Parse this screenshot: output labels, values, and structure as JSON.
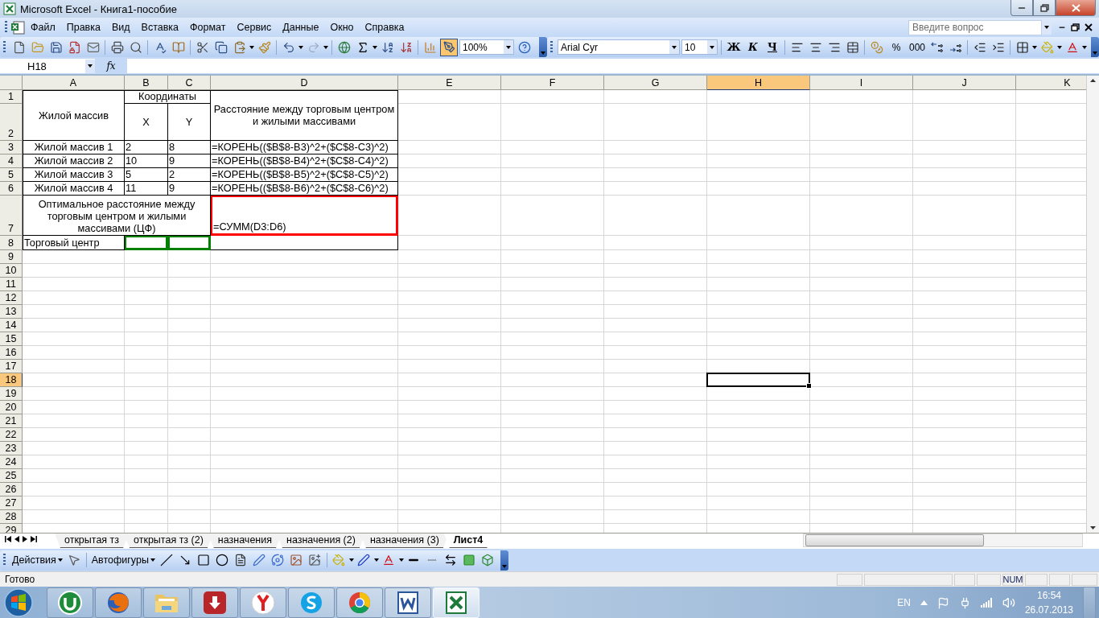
{
  "window": {
    "title": "Microsoft Excel - Книга1-пособие"
  },
  "menu": [
    "Файл",
    "Правка",
    "Вид",
    "Вставка",
    "Формат",
    "Сервис",
    "Данные",
    "Окно",
    "Справка"
  ],
  "help_search": {
    "placeholder": "Введите вопрос"
  },
  "standard_toolbar": {
    "zoom": "100%",
    "drawing_on": true
  },
  "formatting_toolbar": {
    "font": "Arial Cyr",
    "size": "10",
    "bold": "Ж",
    "italic": "К",
    "underline": "Ч",
    "percent": "%",
    "thousands": "000"
  },
  "formula_bar": {
    "name_box": "H18",
    "fx": "fx"
  },
  "columns": [
    {
      "label": "A",
      "selected": false
    },
    {
      "label": "B",
      "selected": false
    },
    {
      "label": "C",
      "selected": false
    },
    {
      "label": "D",
      "selected": false
    },
    {
      "label": "E",
      "selected": false
    },
    {
      "label": "F",
      "selected": false
    },
    {
      "label": "G",
      "selected": false
    },
    {
      "label": "H",
      "selected": true
    },
    {
      "label": "I",
      "selected": false
    },
    {
      "label": "J",
      "selected": false
    },
    {
      "label": "K",
      "selected": false
    }
  ],
  "rows": [
    {
      "label": "1",
      "selected": false
    },
    {
      "label": "2",
      "selected": false
    },
    {
      "label": "3",
      "selected": false
    },
    {
      "label": "4",
      "selected": false
    },
    {
      "label": "5",
      "selected": false
    },
    {
      "label": "6",
      "selected": false
    },
    {
      "label": "7",
      "selected": false
    },
    {
      "label": "8",
      "selected": false
    },
    {
      "label": "9",
      "selected": false
    },
    {
      "label": "10",
      "selected": false
    },
    {
      "label": "11",
      "selected": false
    },
    {
      "label": "12",
      "selected": false
    },
    {
      "label": "13",
      "selected": false
    },
    {
      "label": "14",
      "selected": false
    },
    {
      "label": "15",
      "selected": false
    },
    {
      "label": "16",
      "selected": false
    },
    {
      "label": "17",
      "selected": false
    },
    {
      "label": "18",
      "selected": true
    },
    {
      "label": "19",
      "selected": false
    },
    {
      "label": "20",
      "selected": false
    },
    {
      "label": "21",
      "selected": false
    },
    {
      "label": "22",
      "selected": false
    },
    {
      "label": "23",
      "selected": false
    },
    {
      "label": "24",
      "selected": false
    },
    {
      "label": "25",
      "selected": false
    },
    {
      "label": "26",
      "selected": false
    },
    {
      "label": "27",
      "selected": false
    },
    {
      "label": "28",
      "selected": false
    },
    {
      "label": "29",
      "selected": false
    }
  ],
  "cells": [
    {
      "text": "Жилой массив"
    },
    {
      "text": "Координаты"
    },
    {
      "text": "X"
    },
    {
      "text": "Y"
    },
    {
      "text": "Расстояние между торговым центром и жилыми массивами"
    },
    {
      "text": "Жилой массив 1"
    },
    {
      "text": "2"
    },
    {
      "text": "8"
    },
    {
      "text": "=КОРЕНЬ(($B$8-B3)^2+($C$8-C3)^2)"
    },
    {
      "text": "Жилой массив 2"
    },
    {
      "text": "10"
    },
    {
      "text": "9"
    },
    {
      "text": "=КОРЕНЬ(($B$8-B4)^2+($C$8-C4)^2)"
    },
    {
      "text": "Жилой массив 3"
    },
    {
      "text": "5"
    },
    {
      "text": "2"
    },
    {
      "text": "=КОРЕНЬ(($B$8-B5)^2+($C$8-C5)^2)"
    },
    {
      "text": "Жилой массив 4"
    },
    {
      "text": "11"
    },
    {
      "text": "9"
    },
    {
      "text": "=КОРЕНЬ(($B$8-B6)^2+($C$8-C6)^2)"
    },
    {
      "text": "Оптимальное расстояние между торговым центром и жилыми массивами (ЦФ)"
    },
    {
      "text": "=СУММ(D3:D6)",
      "color": "#ff0000"
    },
    {
      "text": "Торговый центр"
    },
    {
      "color": "#008000"
    },
    {
      "color": "#008000"
    }
  ],
  "sheet_tabs": [
    {
      "label": "открытая тз",
      "selected": false
    },
    {
      "label": "открытая тз (2)",
      "selected": false
    },
    {
      "label": "назначения",
      "selected": false
    },
    {
      "label": "назначения (2)",
      "selected": false
    },
    {
      "label": "назначения (3)",
      "selected": false
    },
    {
      "label": "Лист4",
      "selected": true
    }
  ],
  "drawing_toolbar": {
    "actions": "Действия",
    "autoshapes": "Автофигуры"
  },
  "status_bar": {
    "text": "Готово",
    "num": "NUM"
  },
  "taskbar": {
    "apps": [
      {
        "kind": "torrent",
        "selected": false
      },
      {
        "kind": "fox",
        "selected": false
      },
      {
        "kind": "folder",
        "selected": false
      },
      {
        "kind": "download",
        "selected": false
      },
      {
        "kind": "round",
        "selected": false
      },
      {
        "kind": "chat",
        "selected": false
      },
      {
        "kind": "ring",
        "selected": false
      },
      {
        "kind": "word",
        "selected": false
      },
      {
        "kind": "excel",
        "selected": true
      }
    ],
    "language": "EN",
    "time": "16:54",
    "date": "26.07.2013"
  }
}
